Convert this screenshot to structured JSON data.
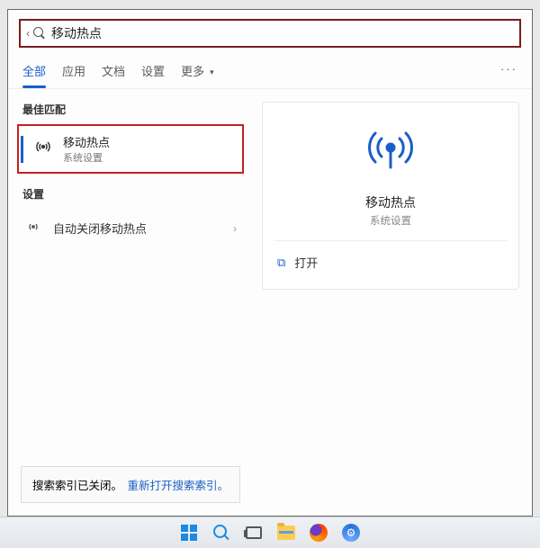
{
  "search": {
    "value": "移动热点"
  },
  "tabs": {
    "all": "全部",
    "apps": "应用",
    "docs": "文档",
    "settings": "设置",
    "more": "更多"
  },
  "sections": {
    "best_match": "最佳匹配",
    "settings": "设置"
  },
  "best": {
    "title": "移动热点",
    "subtitle": "系统设置"
  },
  "settings_results": {
    "auto_off": "自动关闭移动热点"
  },
  "footer": {
    "status": "搜索索引已关闭。",
    "link": "重新打开搜索索引。"
  },
  "preview": {
    "title": "移动热点",
    "subtitle": "系统设置",
    "open": "打开"
  }
}
